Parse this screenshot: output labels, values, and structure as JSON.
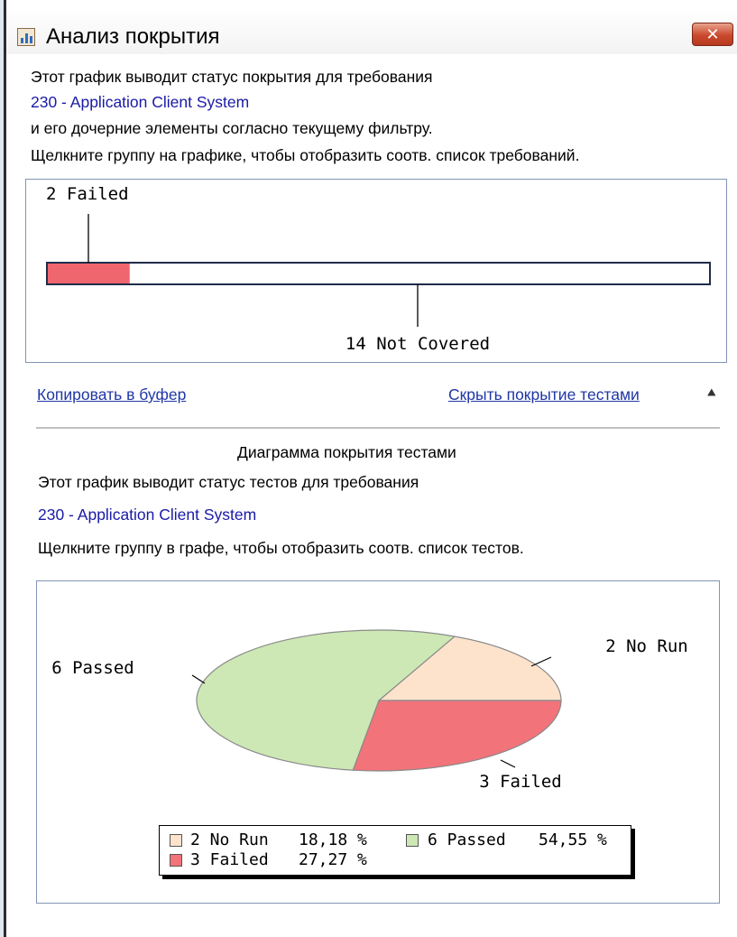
{
  "window": {
    "title": "Анализ покрытия",
    "close_label": "✕",
    "icon": "bar-chart-icon"
  },
  "coverage": {
    "line1": "Этот график выводит статус покрытия для требования",
    "requirement": "230 - Application Client System",
    "line2": "и его дочерние элементы согласно текущему фильтру.",
    "line3": "Щелкните группу на графике, чтобы отобразить соотв. список требований.",
    "bar": {
      "total": 16,
      "segments": [
        {
          "label": "2 Failed",
          "value": 2,
          "color": "#f0666e"
        },
        {
          "label": "14 Not Covered",
          "value": 14,
          "color": "#ffffff"
        }
      ]
    }
  },
  "links": {
    "copy": "Копировать в буфер",
    "hide": "Скрыть покрытие тестами",
    "hide_icon": "double-chevron-up-icon",
    "hide_glyph": "≈"
  },
  "tests": {
    "heading": "Диаграмма покрытия тестами",
    "line1": "Этот график выводит статус тестов для требования",
    "requirement": "230 - Application Client System",
    "line2": "Щелкните группу в графе, чтобы отобразить соотв. список тестов."
  },
  "chart_data": {
    "type": "pie",
    "slices": [
      {
        "label": "2 No Run",
        "value": 2,
        "percent": "18,18 %",
        "color": "#fde3cc"
      },
      {
        "label": "3 Failed",
        "value": 3,
        "percent": "27,27 %",
        "color": "#f2737a"
      },
      {
        "label": "6 Passed",
        "value": 6,
        "percent": "54,55 %",
        "color": "#cde8b4"
      }
    ],
    "legend_placement": "bottom"
  }
}
